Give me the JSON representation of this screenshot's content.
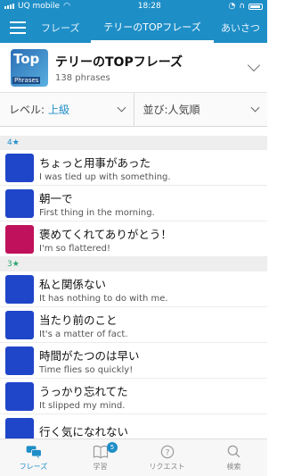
{
  "status": {
    "carrier": "UQ mobile",
    "time": "18:28"
  },
  "nav": {
    "tabs": [
      {
        "label": "フレーズ"
      },
      {
        "label": "テリーのTOPフレーズ"
      },
      {
        "label": "あいさつ"
      }
    ]
  },
  "collection": {
    "logo_top": "Top",
    "logo_sub": "Phrases",
    "title": "テリーのTOPフレーズ",
    "count": "138 phrases"
  },
  "filters": {
    "level_label": "レベル:",
    "level_value": "上級",
    "sort_label": "並び:",
    "sort_value": "人気順"
  },
  "sections": [
    {
      "header": "4★",
      "items": [
        {
          "jp": "ちょっと用事があった",
          "en": "I was tied up with something.",
          "color": "#1f45c9"
        },
        {
          "jp": "朝一で",
          "en": "First thing in the morning.",
          "color": "#1f45c9"
        },
        {
          "jp": "褒めてくれてありがとう！",
          "en": "I'm so flattered!",
          "color": "#c0125c"
        }
      ]
    },
    {
      "header": "3★",
      "items": [
        {
          "jp": "私と関係ない",
          "en": "It has nothing to do with me.",
          "color": "#1f45c9"
        },
        {
          "jp": "当たり前のこと",
          "en": "It's a matter of fact.",
          "color": "#1f45c9"
        },
        {
          "jp": "時間がたつのは早い",
          "en": "Time flies so quickly!",
          "color": "#1f45c9"
        },
        {
          "jp": "うっかり忘れてた",
          "en": "It slipped my mind.",
          "color": "#1f45c9"
        },
        {
          "jp": "行く気になれない",
          "en": "",
          "color": "#1f45c9"
        }
      ]
    }
  ],
  "bottom": {
    "items": [
      {
        "label": "フレーズ",
        "icon": "chat-bubbles-icon",
        "active": true
      },
      {
        "label": "学習",
        "icon": "book-icon",
        "badge": "5"
      },
      {
        "label": "リクエスト",
        "icon": "question-icon"
      },
      {
        "label": "検索",
        "icon": "search-icon"
      }
    ]
  },
  "colors": {
    "brand": "#1e8ec7",
    "section4": "#1e8ec7",
    "section3": "#2aa56b"
  }
}
